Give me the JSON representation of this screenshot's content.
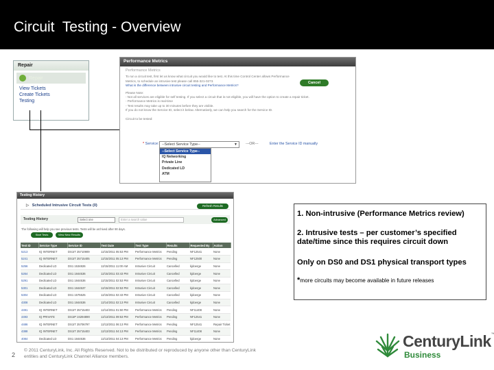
{
  "slide": {
    "title": "Circuit  Testing - Overview",
    "page_number": "2",
    "footer": "© 2011 CenturyLink, Inc. All Rights Reserved. Not to be distributed or reproduced by anyone other than CenturyLink entities and CenturyLink Channel Alliance members.",
    "colors": {
      "title_bar": "#000000",
      "brand_green": "#2f8a3a",
      "logo_gray": "#444444"
    }
  },
  "repair_nav": {
    "header": "Repair",
    "active_item": "Repair",
    "items": [
      "View Tickets",
      "Create Tickets",
      "Testing"
    ]
  },
  "performance_metrics": {
    "header": "Performance Metrics",
    "subtitle": "Performance Metrics",
    "intro": "To run a circuit test, first let us know what circuit you would like to test. At this time Control Center allows Performance Metrics, to schedule an intrusive test please call 855-321-0273.",
    "link": "What is the difference between intrusive circuit testing and Performance Metrics?",
    "note_title": "Please Note:",
    "notes": [
      "- Not all services are eligible for self testing. If you select a circuit that is not eligible, you will have the option to create a repair ticket.",
      "- Performance Metrics is real-time",
      "- Test results may take up to 30 minutes before they are visible.",
      "If you do not know the Service ID, select it below. Alternatively, we can help you search for the Service ID."
    ],
    "circuit_label": "Circuit to be tested:",
    "service_label": "Service:",
    "service_select_value": "--Select Service Type--",
    "service_options": [
      "--Select Service Type--",
      "IQ Networking",
      "Private Line",
      "Dedicated LD",
      "ATM"
    ],
    "or_text": "---OR---",
    "manual_link": "Enter the Service ID manually",
    "cancel_label": "Cancel"
  },
  "testing_history": {
    "header": "Testing History",
    "subheader": "Scheduled Intrusive Circuit Tests (0)",
    "refresh_label": "Refresh Results",
    "search_label": "Testing History",
    "search_select": "Select one",
    "search_placeholder": "Enter a search value",
    "advanced_label": "Advanced",
    "note": "The following will help you see previous tests. Tests will be archived after 90 days.",
    "btn_left": "Start Tests",
    "btn_right": "View New Results",
    "columns": [
      "Test ID",
      "Service Type",
      "Service ID",
      "Test Date",
      "Test Type",
      "Results",
      "Requested By",
      "Action"
    ],
    "rows": [
      [
        "5213",
        "IQ INTERNET",
        "DS1IT 25710909",
        "12/15/2011 05:53 PM",
        "Performance Metrics",
        "Pending",
        "NF12541",
        "None"
      ],
      [
        "5241",
        "IQ INTERNET",
        "DS1IT 25715405",
        "12/15/2011 05:13 PM",
        "Performance Metrics",
        "Pending",
        "NF12500",
        "None"
      ],
      [
        "5256",
        "Dedicated LD",
        "DS1 1534826",
        "12/15/2011 11:00 AM",
        "Intrusive Circuit",
        "Cancelled",
        "kjdoerge",
        "None"
      ],
      [
        "5264",
        "Dedicated LD",
        "DS1 1844536",
        "12/15/2011 03:43 PM",
        "Intrusive Circuit",
        "Cancelled",
        "kjdoerge",
        "None"
      ],
      [
        "5291",
        "Dedicated LD",
        "DS1 1844536",
        "12/15/2011 02:53 PM",
        "Intrusive Circuit",
        "Cancelled",
        "kjdoerge",
        "None"
      ],
      [
        "5301",
        "Dedicated LD",
        "DS1 1844537",
        "12/15/2011 02:53 PM",
        "Intrusive Circuit",
        "Cancelled",
        "kjdoerge",
        "None"
      ],
      [
        "5304",
        "Dedicated LD",
        "DS1 1575525",
        "12/15/2011 02:43 PM",
        "Intrusive Circuit",
        "Cancelled",
        "kjdoerge",
        "None"
      ],
      [
        "4308",
        "Dedicated LD",
        "DS1 1844536",
        "12/14/2011 02:13 PM",
        "Intrusive Circuit",
        "Cancelled",
        "kjdoerge",
        "None"
      ],
      [
        "4491",
        "IQ INTERNET",
        "DS1IT 25715403",
        "12/14/2011 01:50 PM",
        "Performance Metrics",
        "Pending",
        "NF11408",
        "None"
      ],
      [
        "4493",
        "IQ PRIVATE",
        "DS1IP 24294890",
        "12/13/2011 09:53 PM",
        "Performance Metrics",
        "Pending",
        "NF12541",
        "None"
      ],
      [
        "4486",
        "IQ INTERNET",
        "DS1IT 25706797",
        "12/13/2011 06:13 PM",
        "Performance Metrics",
        "Pending",
        "NF12541",
        "Repair Ticket"
      ],
      [
        "4388",
        "IQ INTERNET",
        "DS1IT 25715403",
        "12/13/2011 04:13 PM",
        "Performance Metrics",
        "Pending",
        "NF11408",
        "None"
      ],
      [
        "4084",
        "Dedicated LD",
        "DS1 1844536",
        "12/13/2011 04:13 PM",
        "Performance Metrics",
        "Pending",
        "kjdoerge",
        "None"
      ]
    ]
  },
  "callout": {
    "line1": "1. Non-intrusive (Performance Metrics review)",
    "line2": "2. Intrusive tests – per customer’s specified date/time since this requires circuit down",
    "line3": "Only on DS0 and DS1 physical transport types",
    "asterisk": "*",
    "note": "more circuits may become available in future releases"
  },
  "logo": {
    "name": "CenturyLink",
    "tm": "™",
    "sub": "Business"
  }
}
